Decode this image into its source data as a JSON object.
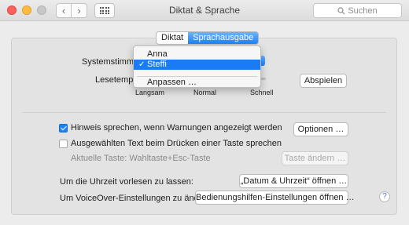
{
  "window": {
    "title": "Diktat & Sprache",
    "search_placeholder": "Suchen"
  },
  "tabs": [
    {
      "label": "Diktat",
      "active": false
    },
    {
      "label": "Sprachausgabe",
      "active": true
    }
  ],
  "voice": {
    "label": "Systemstimme:",
    "menu_items": [
      "Anna",
      "Steffi",
      "Anpassen …"
    ],
    "selected": "Steffi"
  },
  "rate": {
    "label": "Lesetempo:",
    "ticks": [
      "Langsam",
      "Normal",
      "Schnell"
    ],
    "play_button": "Abspielen"
  },
  "alerts": {
    "checkbox_label": "Hinweis sprechen, wenn Warnungen angezeigt werden",
    "checked": true,
    "options_button": "Optionen …"
  },
  "speak_selection": {
    "checkbox_label": "Ausgewählten Text beim Drücken einer Taste sprechen",
    "checked": false,
    "current_key": "Aktuelle Taste: Wahltaste+Esc-Taste",
    "change_key_button": "Taste ändern …"
  },
  "time": {
    "label": "Um die Uhrzeit vorlesen zu lassen:",
    "button": "„Datum & Uhrzeit“ öffnen …"
  },
  "voiceover": {
    "label": "Um VoiceOver-Einstellungen zu ändern:",
    "button": "Bedienungshilfen-Einstellungen öffnen …"
  },
  "help": "?",
  "colors": {
    "accent": "#1a82fb",
    "close": "#fc615d",
    "minimize": "#fdbc40"
  }
}
